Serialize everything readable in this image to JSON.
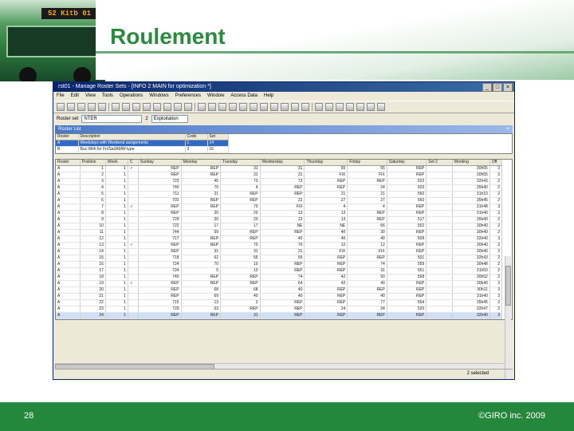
{
  "slide": {
    "title": "Roulement",
    "bus_sign": "52 Kitb 01",
    "page_number": "28",
    "copyright": "©GIRO inc. 2009"
  },
  "window": {
    "title": "rst01 - Manage Roster Sets - [INFO 2 MAIN for optimization *]",
    "buttons": [
      "_",
      "□",
      "×"
    ]
  },
  "menu": [
    "File",
    "Edit",
    "View",
    "Tools",
    "Operations",
    "Windows",
    "Preferences",
    "Window",
    "Access Data",
    "Help"
  ],
  "roster_set": {
    "label": "Roster set",
    "code": "NTER",
    "number": "2",
    "description": "Exploitation"
  },
  "roster_list": {
    "title": "Roster List",
    "close": "×",
    "headers": [
      "Roster",
      "Description",
      "Code",
      "Set"
    ],
    "rows": [
      {
        "roster": "A",
        "description": "Weekdays with Weekend assignments",
        "code": "1",
        "set": "14"
      },
      {
        "roster": "B",
        "description": "Bus With for Fri/Sat/AMW-type",
        "code": "3",
        "set": "16"
      }
    ]
  },
  "grid": {
    "headers": [
      "Roster",
      "Position",
      "Week",
      "C",
      "Sunday",
      "Monday",
      "Tuesday",
      "Wednesday",
      "Thursday",
      "Friday",
      "Saturday",
      "Set 2",
      "Working",
      "Off"
    ],
    "rows": [
      [
        "A",
        "1",
        "1",
        "✓",
        "REP",
        "REP",
        "31",
        "31",
        "55",
        "55",
        "REP",
        "30h55",
        "3"
      ],
      [
        "A",
        "2",
        "1",
        "",
        "REP",
        "REP",
        "31",
        "31",
        "FIX",
        "FIX",
        "REP",
        "30h55",
        "3"
      ],
      [
        "A",
        "3",
        "1",
        "",
        "723",
        "45",
        "73",
        "73",
        "REP",
        "REP",
        "522",
        "32h43",
        "2"
      ],
      [
        "A",
        "4",
        "1",
        "",
        "740",
        "70",
        "4",
        "REP",
        "REP",
        "24",
        "503",
        "35h40",
        "2"
      ],
      [
        "A",
        "5",
        "1",
        "",
        "711",
        "21",
        "REP",
        "REP",
        "21",
        "21",
        "560",
        "31h10",
        "2"
      ],
      [
        "A",
        "6",
        "1",
        "",
        "702",
        "REP",
        "REP",
        "22",
        "27",
        "27",
        "560",
        "35h45",
        "2"
      ],
      [
        "A",
        "7",
        "1",
        "✓",
        "REP",
        "REP",
        "70",
        "FIX",
        "4",
        "4",
        "REP",
        "31h48",
        "3"
      ],
      [
        "A",
        "8",
        "1",
        "",
        "REP",
        "20",
        "20",
        "13",
        "13",
        "REP",
        "REP",
        "31h40",
        "3"
      ],
      [
        "A",
        "9",
        "1",
        "",
        "729",
        "20",
        "20",
        "13",
        "13",
        "REP",
        "517",
        "35h40",
        "2"
      ],
      [
        "A",
        "10",
        "1",
        "",
        "722",
        "17",
        "17",
        "NE",
        "NE",
        "66",
        "552",
        "30h40",
        "2"
      ],
      [
        "A",
        "11",
        "1",
        "",
        "744",
        "59",
        "REP",
        "REP",
        "40",
        "30",
        "REP",
        "30h40",
        "2"
      ],
      [
        "A",
        "12",
        "1",
        "",
        "717",
        "REP",
        "REP",
        "40",
        "40",
        "40",
        "509",
        "32h40",
        "3"
      ],
      [
        "A",
        "13",
        "1",
        "✓",
        "REP",
        "REP",
        "70",
        "70",
        "12",
        "12",
        "REP",
        "30h40",
        "3"
      ],
      [
        "A",
        "14",
        "1",
        "",
        "REP",
        "31",
        "31",
        "31",
        "FIX",
        "FIX",
        "REP",
        "30h40",
        "3"
      ],
      [
        "A",
        "15",
        "1",
        "",
        "718",
        "62",
        "55",
        "55",
        "REP",
        "REP",
        "501",
        "32h43",
        "2"
      ],
      [
        "A",
        "16",
        "1",
        "",
        "724",
        "70",
        "10",
        "REP",
        "REP",
        "74",
        "559",
        "30h48",
        "2"
      ],
      [
        "A",
        "17",
        "1",
        "",
        "724",
        "5",
        "10",
        "REP",
        "REP",
        "31",
        "561",
        "31h50",
        "2"
      ],
      [
        "A",
        "18",
        "1",
        "",
        "740",
        "REP",
        "REP",
        "74",
        "42",
        "50",
        "568",
        "30h52",
        "2"
      ],
      [
        "A",
        "19",
        "1",
        "✓",
        "REP",
        "REP",
        "REP",
        "64",
        "42",
        "40",
        "REP",
        "30h40",
        "3"
      ],
      [
        "A",
        "20",
        "1",
        "",
        "REP",
        "68",
        "68",
        "40",
        "REP",
        "REP",
        "REP",
        "30h11",
        "3"
      ],
      [
        "A",
        "21",
        "1",
        "",
        "REP",
        "69",
        "40",
        "40",
        "REP",
        "40",
        "REP",
        "31h40",
        "3"
      ],
      [
        "A",
        "22",
        "1",
        "",
        "715",
        "13",
        "3",
        "REP",
        "REP",
        "77",
        "564",
        "35h45",
        "2"
      ],
      [
        "A",
        "23",
        "1",
        "",
        "729",
        "03",
        "REP",
        "REP",
        "24",
        "24",
        "520",
        "32h47",
        "2"
      ],
      [
        "A",
        "24",
        "1",
        "",
        "REP",
        "REP",
        "31",
        "REP",
        "REP",
        "REP",
        "REP",
        "32h40",
        "3"
      ]
    ]
  },
  "status": {
    "selected": "2 selected"
  },
  "colors": {
    "brand_green": "#2a8a3e",
    "footer_green": "#24883c",
    "window_title": "#0a246a",
    "selection": "#316ac5"
  }
}
